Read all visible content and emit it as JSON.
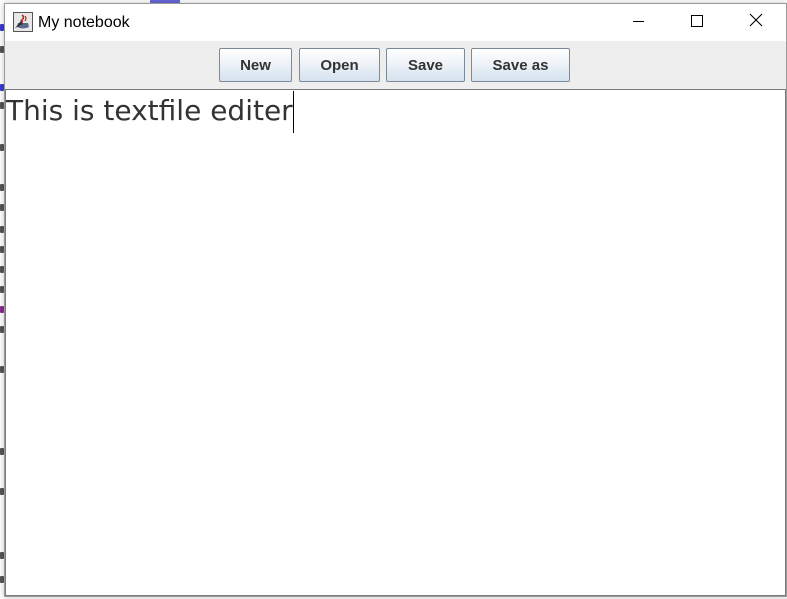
{
  "window": {
    "title": "My notebook",
    "icon": "java-coffee-cup-icon",
    "controls": {
      "minimize": "minimize-icon",
      "maximize": "maximize-icon",
      "close": "close-icon"
    }
  },
  "toolbar": {
    "new_label": "New",
    "open_label": "Open",
    "save_label": "Save",
    "save_as_label": "Save as"
  },
  "editor": {
    "content": "This is textfile editer"
  },
  "colors": {
    "button_border": "#7a8a99",
    "button_gradient_bottom": "#d5e2ee",
    "toolbar_bg": "#eeeeee",
    "editor_text": "#333333"
  }
}
